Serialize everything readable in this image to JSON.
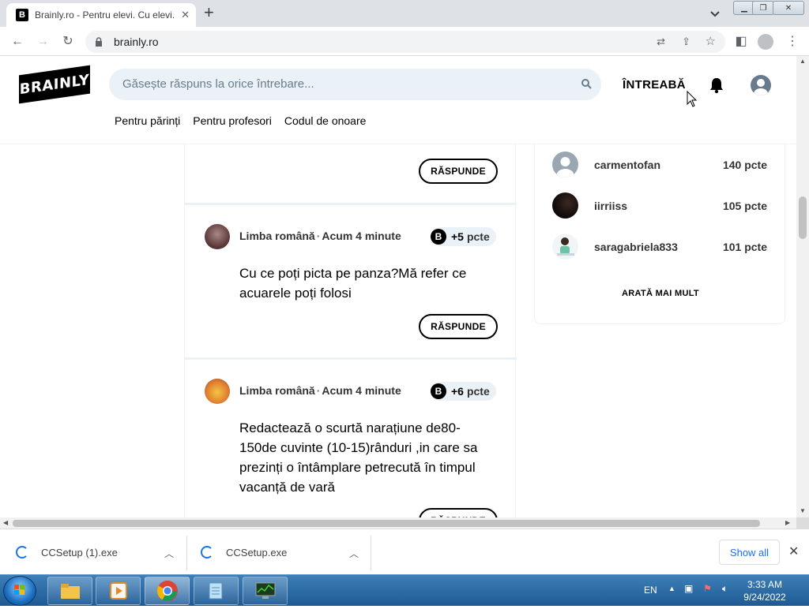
{
  "browser": {
    "tab_title": "Brainly.ro - Pentru elevi. Cu elevi.",
    "favicon_letter": "B",
    "url": "brainly.ro"
  },
  "header": {
    "logo_text": "BRAINLY",
    "search_placeholder": "Găsește răspuns la orice întrebare...",
    "ask_label": "ÎNTREABĂ",
    "nav": [
      "Pentru părinți",
      "Pentru profesori",
      "Codul de onoare"
    ]
  },
  "questions": [
    {
      "subject": "Limba română",
      "time": "Acum 4 minute",
      "points": "+5",
      "points_unit": "pcte",
      "text": "Cu ce poți picta pe panza?Mă refer ce acuarele poți folosi",
      "answer_label": "RĂSPUNDE"
    },
    {
      "subject": "Limba română",
      "time": "Acum 4 minute",
      "points": "+6",
      "points_unit": "pcte",
      "text": "Redactează o scurtă narațiune de80-150de cuvinte (10-15)rânduri ,in care sa prezinți o întâmplare petrecută în timpul vacanță de vară",
      "answer_label": "RĂSPUNDE"
    }
  ],
  "top_answer_label": "RĂSPUNDE",
  "leaderboard": {
    "users": [
      {
        "name": "carmentofan",
        "points": "140 pcte"
      },
      {
        "name": "iirriiss",
        "points": "105 pcte"
      },
      {
        "name": "saragabriela833",
        "points": "101 pcte"
      }
    ],
    "more_label": "ARATĂ MAI MULT"
  },
  "downloads": {
    "items": [
      {
        "name": "CCSetup (1).exe"
      },
      {
        "name": "CCSetup.exe"
      }
    ],
    "show_all": "Show all"
  },
  "taskbar": {
    "lang": "EN",
    "time": "3:33 AM",
    "date": "9/24/2022"
  },
  "colors": {
    "accent_bg": "#ebf2f7",
    "text_primary": "#000000",
    "link_blue": "#1a73e8"
  }
}
